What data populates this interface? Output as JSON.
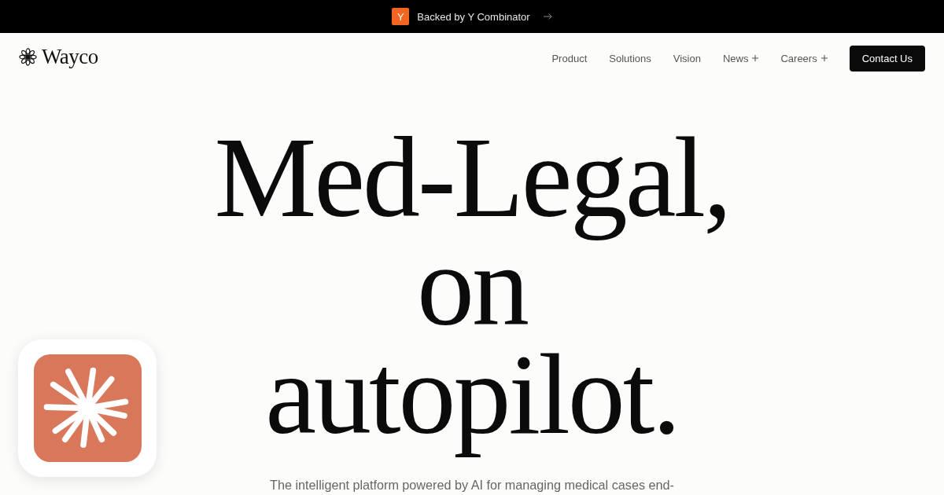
{
  "announcement": {
    "logo_letter": "Y",
    "text": "Backed by Y Combinator"
  },
  "header": {
    "brand": "Wayco",
    "nav": [
      {
        "label": "Product",
        "has_menu": false
      },
      {
        "label": "Solutions",
        "has_menu": false
      },
      {
        "label": "Vision",
        "has_menu": false
      },
      {
        "label": "News",
        "has_menu": true
      },
      {
        "label": "Careers",
        "has_menu": true
      }
    ],
    "cta": "Contact Us"
  },
  "hero": {
    "headline_lines": [
      "Med-Legal,",
      "on",
      "autopilot."
    ],
    "subtitle": "The intelligent platform powered by AI for managing medical cases end-"
  }
}
